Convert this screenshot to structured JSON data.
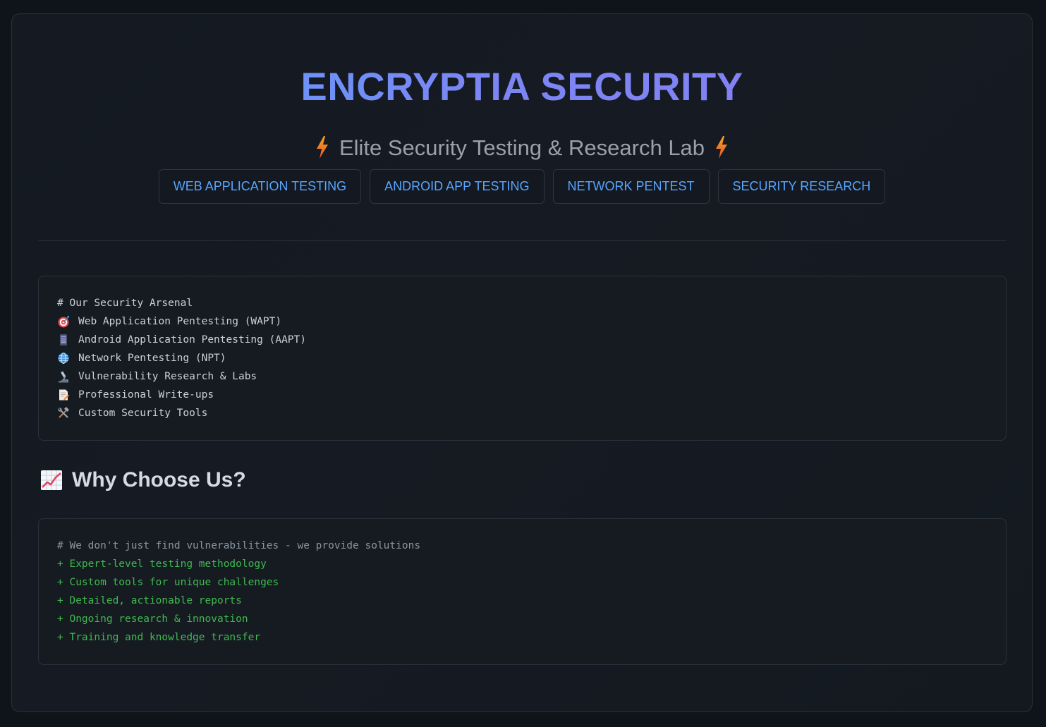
{
  "header": {
    "title": "ENCRYPTIA SECURITY",
    "subtitle": "Elite Security Testing & Research Lab",
    "subtitle_icon": "lightning-bolt"
  },
  "badges": [
    "WEB APPLICATION TESTING",
    "ANDROID APP TESTING",
    "NETWORK PENTEST",
    "SECURITY RESEARCH"
  ],
  "arsenal": {
    "heading": "# Our Security Arsenal",
    "items": [
      {
        "icon": "target-icon",
        "label": "Web Application Pentesting (WAPT)"
      },
      {
        "icon": "phone-icon",
        "label": "Android Application Pentesting (AAPT)"
      },
      {
        "icon": "globe-icon",
        "label": "Network Pentesting (NPT)"
      },
      {
        "icon": "microscope-icon",
        "label": "Vulnerability Research & Labs"
      },
      {
        "icon": "memo-icon",
        "label": "Professional Write-ups"
      },
      {
        "icon": "hammer-wrench-icon",
        "label": "Custom Security Tools"
      }
    ]
  },
  "why": {
    "heading_icon": "chart-increasing-icon",
    "heading": "Why Choose Us?",
    "comment": "# We don't just find vulnerabilities - we provide solutions",
    "points": [
      "+ Expert-level testing methodology",
      "+ Custom tools for unique challenges",
      "+ Detailed, actionable reports",
      "+ Ongoing research & innovation",
      "+ Training and knowledge transfer"
    ]
  },
  "colors": {
    "background": "#0f131a",
    "card": "#161b22",
    "accent_blue": "#58a6ff",
    "title_gradient_end": "#8a7ef5",
    "success_green": "#3fb950",
    "muted": "#8b949e",
    "bolt_orange": "#f0883e"
  }
}
